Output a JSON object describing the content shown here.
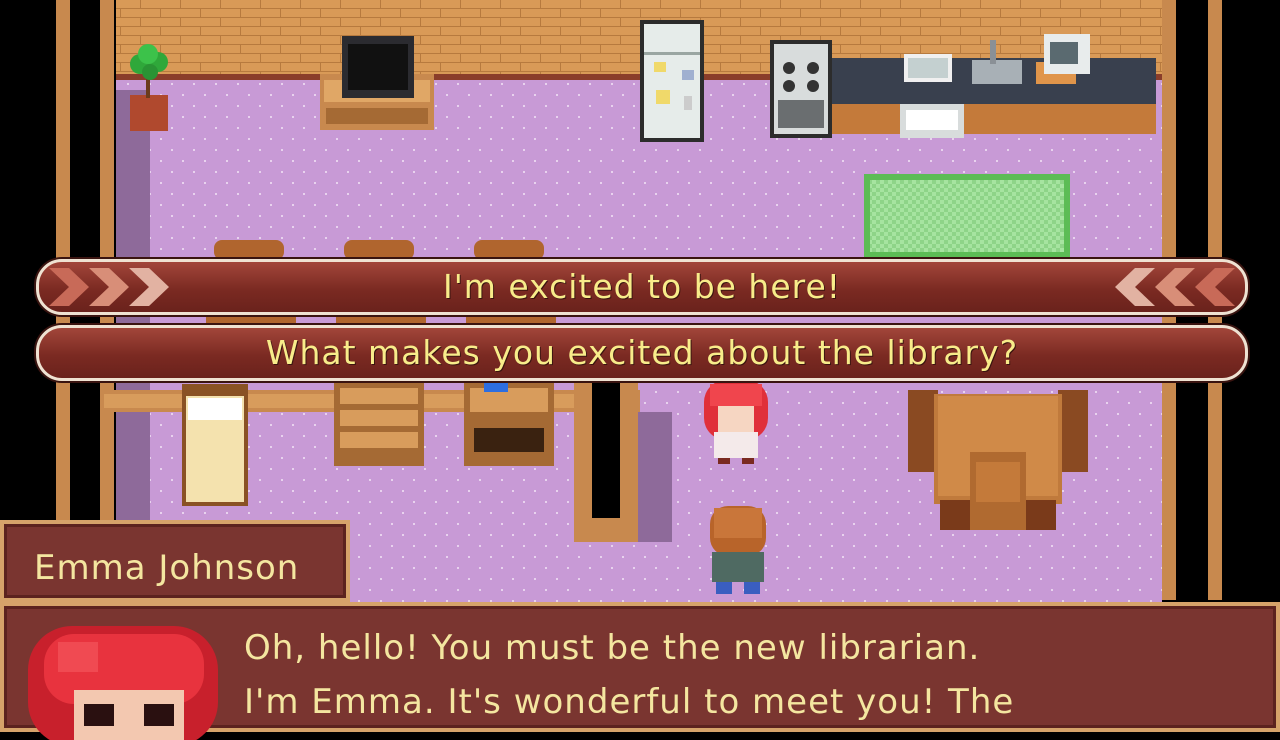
{
  "choices": [
    {
      "label": "I'm excited to be here!"
    },
    {
      "label": "What makes you excited about the library?"
    }
  ],
  "dialog": {
    "speaker": "Emma Johnson",
    "lines": [
      "Oh, hello! You must be the new librarian.",
      "I'm Emma. It's wonderful to meet you! The"
    ]
  },
  "colors": {
    "floor": "#c89ad6",
    "wall_brick": "#d99a57",
    "choice_bar": "#8a3229",
    "choice_text": "#f8ec8a",
    "dialog_bg": "#7a3530",
    "dialog_border": "#d6a36a",
    "dialog_text": "#f4e6a0"
  },
  "icons": [
    "choice-chevron-left-icon",
    "choice-chevron-right-icon"
  ]
}
